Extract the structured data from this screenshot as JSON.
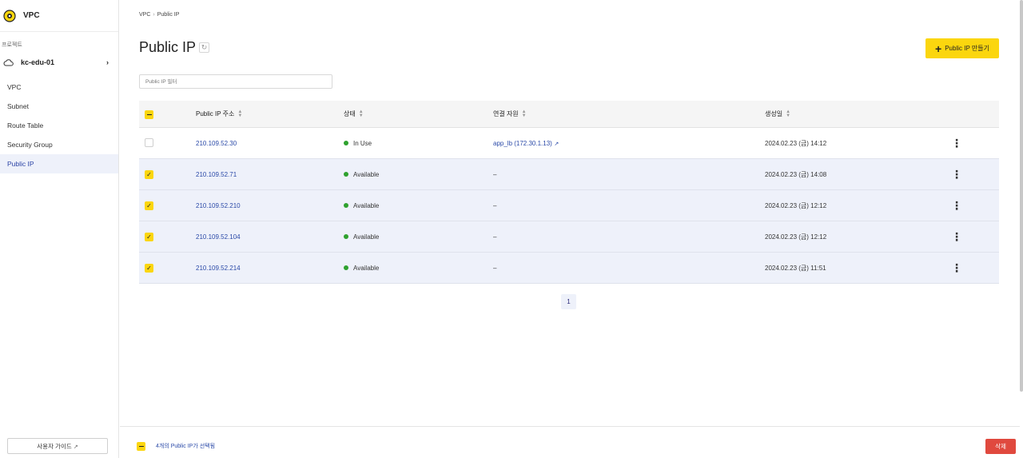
{
  "sidebar": {
    "title": "VPC",
    "project_label": "프로젝트",
    "project_name": "kc-edu-01",
    "items": [
      "VPC",
      "Subnet",
      "Route Table",
      "Security Group",
      "Public IP"
    ],
    "guide_label": "사용자 가이드"
  },
  "breadcrumb": {
    "root": "VPC",
    "current": "Public IP"
  },
  "page": {
    "title": "Public IP",
    "create_button": "Public IP 만들기",
    "filter_placeholder": "Public IP 필터"
  },
  "table": {
    "headers": {
      "ip": "Public IP 주소",
      "status": "상태",
      "resource": "연결 자원",
      "created": "생성일"
    },
    "rows": [
      {
        "ip": "210.109.52.30",
        "status": "In Use",
        "resource": "app_lb (172.30.1.13)",
        "created": "2024.02.23 (금) 14:12",
        "selected": false
      },
      {
        "ip": "210.109.52.71",
        "status": "Available",
        "resource": "–",
        "created": "2024.02.23 (금) 14:08",
        "selected": true
      },
      {
        "ip": "210.109.52.210",
        "status": "Available",
        "resource": "–",
        "created": "2024.02.23 (금) 12:12",
        "selected": true
      },
      {
        "ip": "210.109.52.104",
        "status": "Available",
        "resource": "–",
        "created": "2024.02.23 (금) 12:12",
        "selected": true
      },
      {
        "ip": "210.109.52.214",
        "status": "Available",
        "resource": "–",
        "created": "2024.02.23 (금) 11:51",
        "selected": true
      }
    ]
  },
  "pagination": {
    "current": "1"
  },
  "bottom": {
    "selection_text": "4개의 Public IP가 선택됨",
    "delete_button": "삭제"
  },
  "colors": {
    "accent": "#fbd60e",
    "link": "#2b4aa8",
    "danger": "#e0493e",
    "available": "#2ea12e"
  },
  "icons": {
    "logo": "vpc-logo-icon",
    "project": "cloud-icon",
    "more": "more-vertical-icon",
    "external": "external-link-icon"
  }
}
